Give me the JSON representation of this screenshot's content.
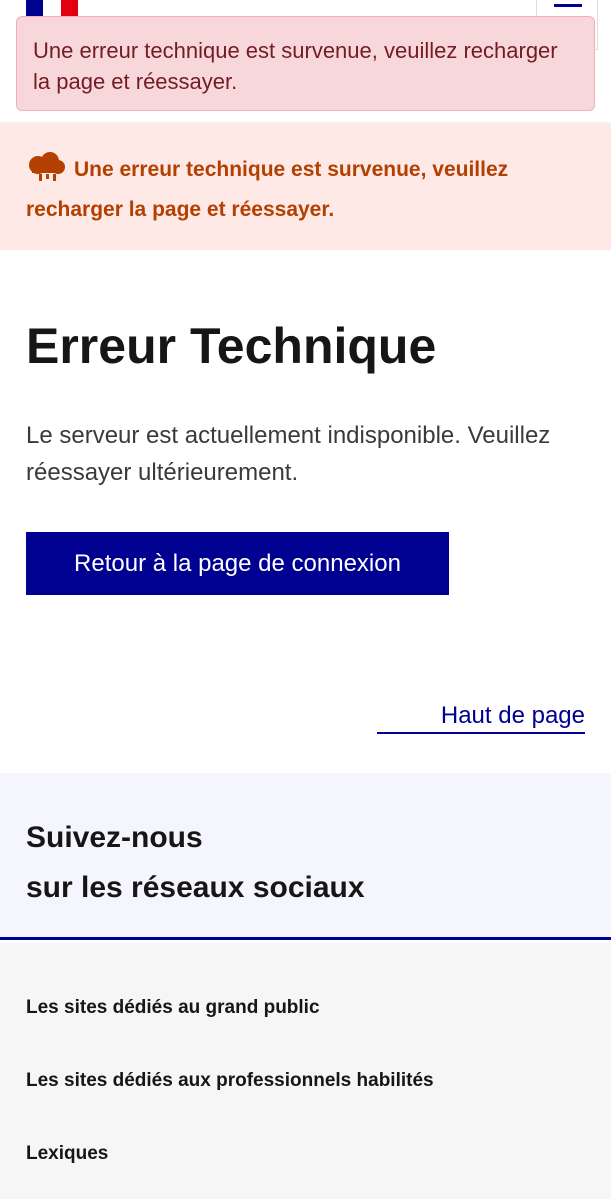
{
  "header": {
    "logo_icon": "republique-francaise-flag-icon",
    "menu_icon": "hamburger-menu-icon"
  },
  "toast": {
    "message": "Une erreur technique est survenue, veuillez recharger la page et réessayer."
  },
  "alert": {
    "icon": "cloud-storm-icon",
    "message": "Une erreur technique est survenue, veuillez recharger la page et réessayer."
  },
  "main": {
    "title": "Erreur Technique",
    "description": "Le serveur est actuellement indisponible. Veuillez réessayer ultérieurement.",
    "primary_button": "Retour à la page de connexion",
    "top_link": "Haut de page"
  },
  "social": {
    "title_line1": "Suivez-nous",
    "title_line2": "sur les réseaux sociaux"
  },
  "footer": {
    "links": [
      "Les sites dédiés au grand public",
      "Les sites dédiés aux professionnels habilités",
      "Lexiques"
    ]
  },
  "colors": {
    "brand_blue": "#000091",
    "toast_bg": "#f8d7da",
    "toast_text": "#721c24",
    "alert_bg": "#ffe9e6",
    "alert_text": "#b34000",
    "social_bg": "#f5f5fe",
    "footer_bg": "#f6f6f6"
  }
}
